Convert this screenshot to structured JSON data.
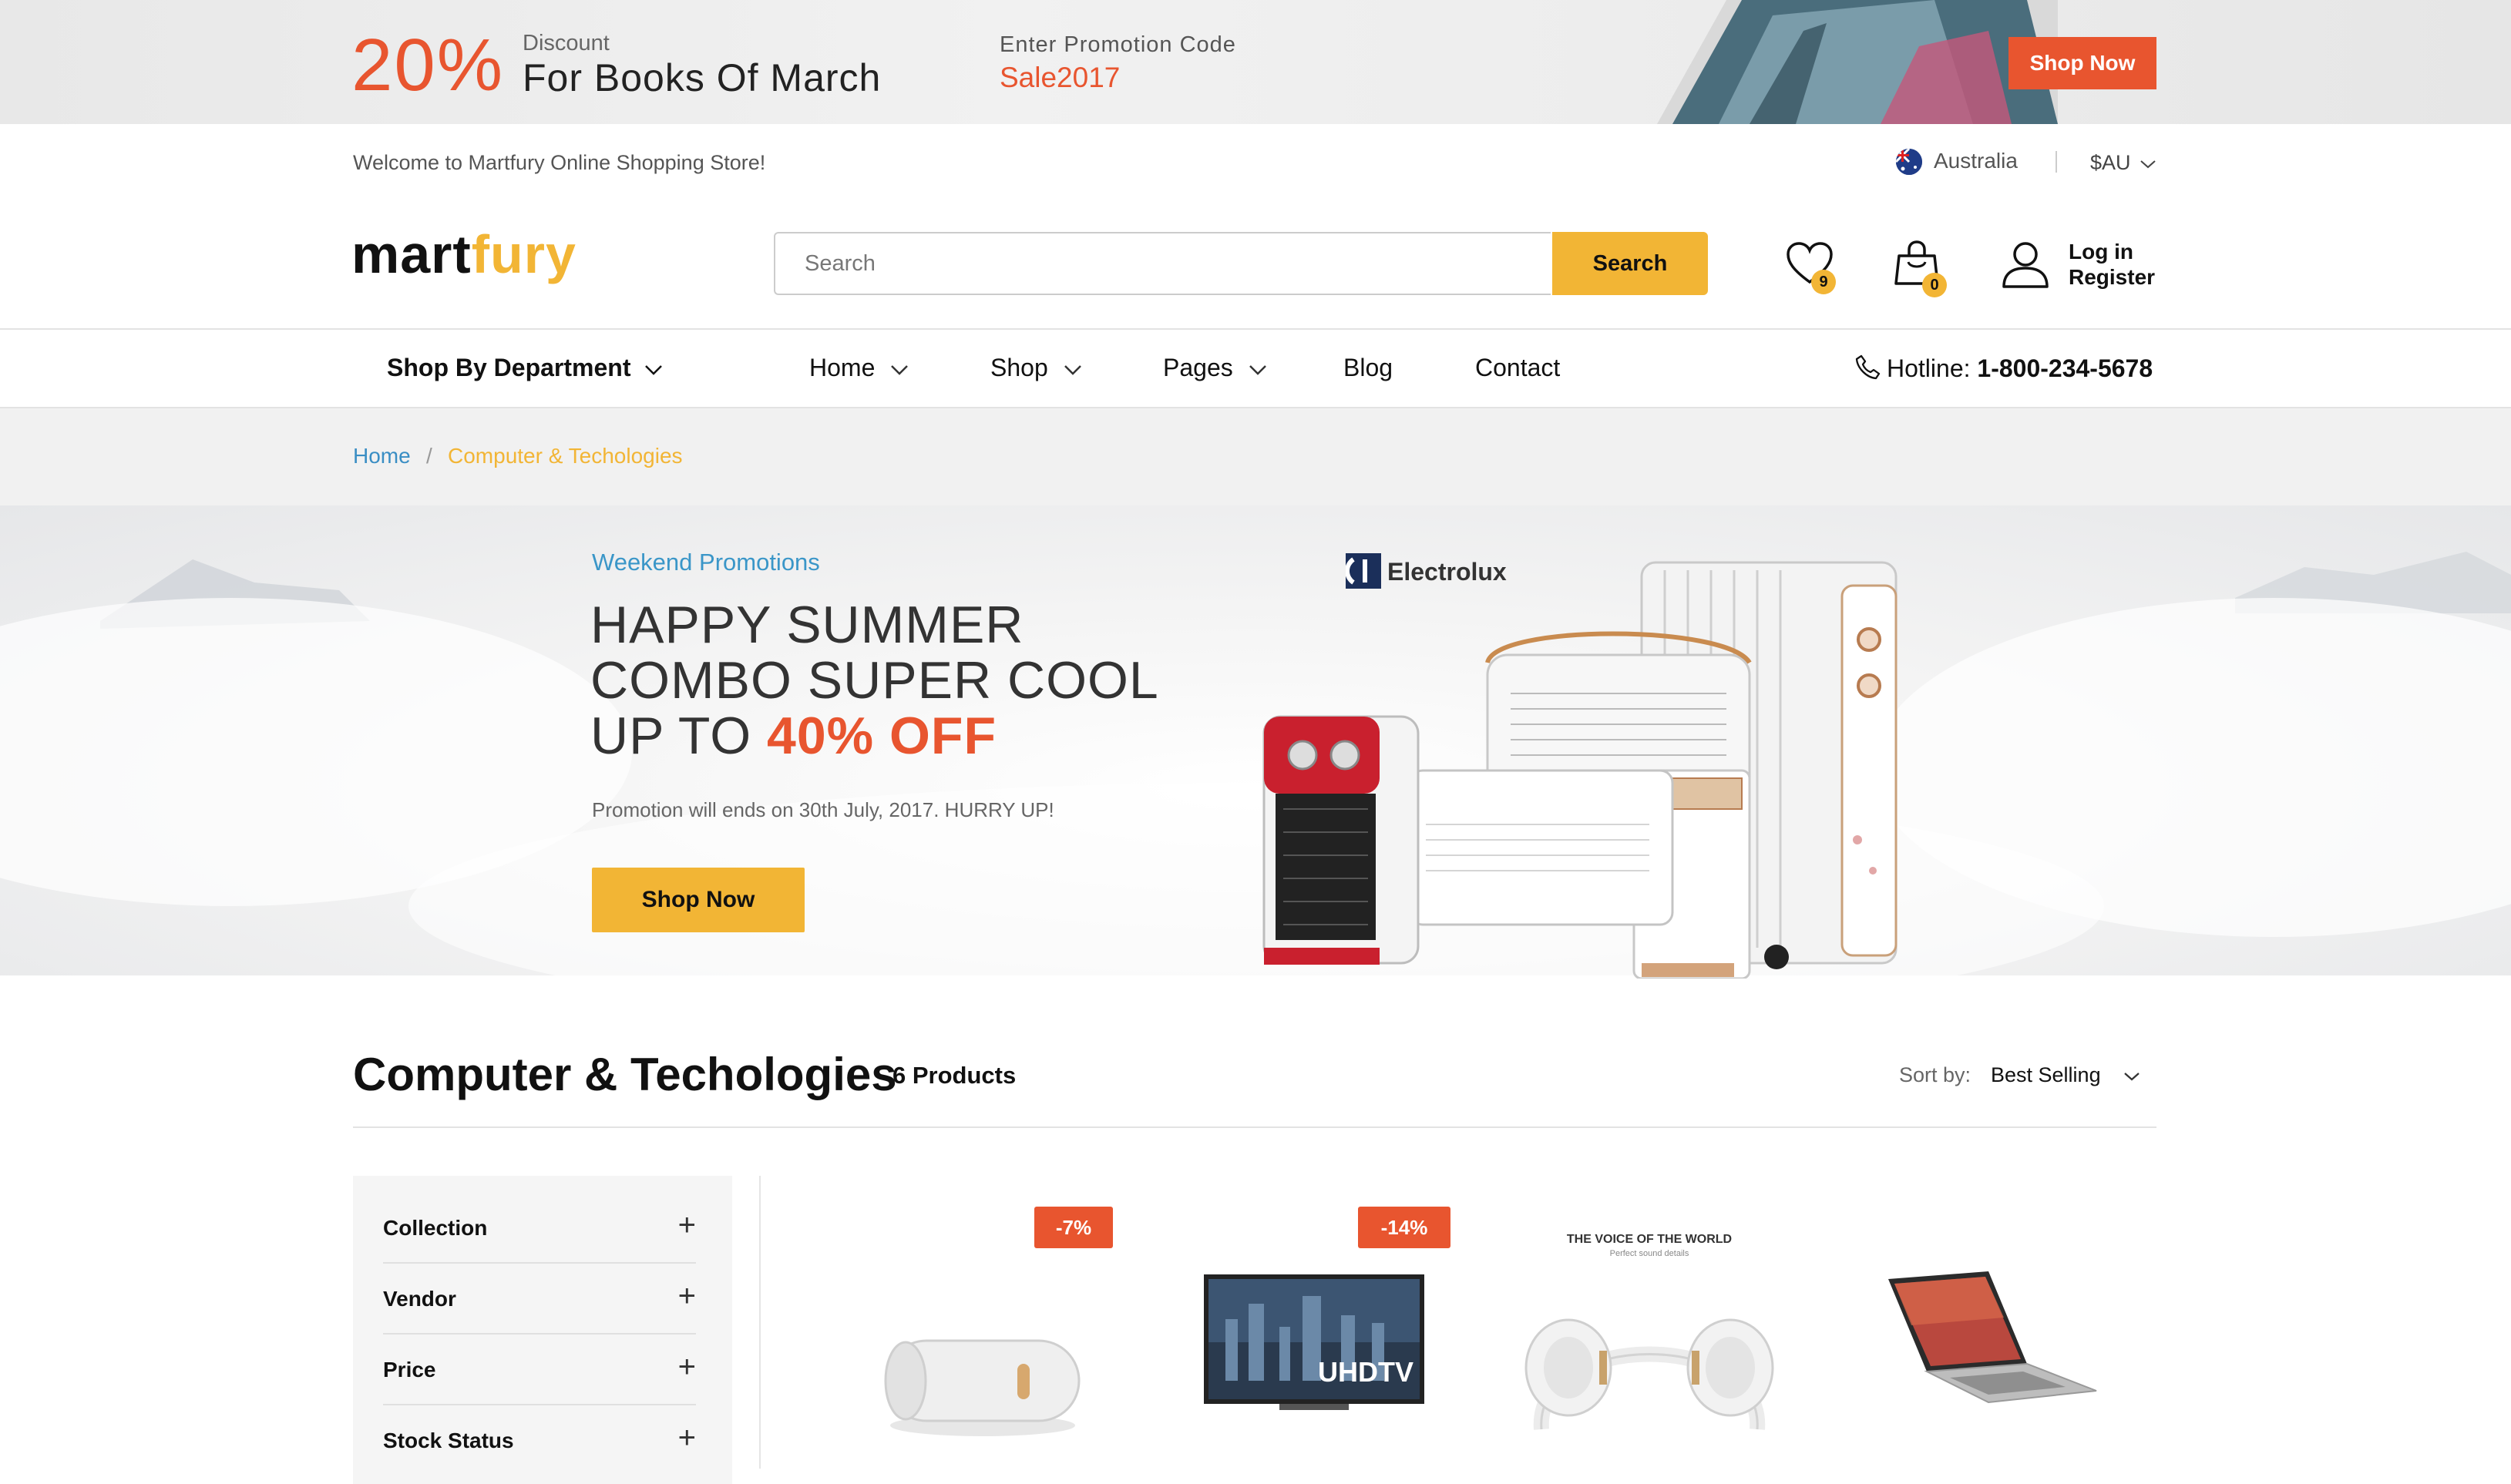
{
  "promo": {
    "percent": "20%",
    "discount_label": "Discount",
    "headline": "For Books Of March",
    "code_label": "Enter Promotion Code",
    "code": "Sale2017",
    "button": "Shop Now"
  },
  "topbar": {
    "welcome": "Welcome to Martfury Online Shopping Store!",
    "country": "Australia",
    "currency": "$AU"
  },
  "header": {
    "logo_main": "mart",
    "logo_accent": "fury",
    "search_placeholder": "Search",
    "search_button": "Search",
    "wishlist_count": "9",
    "cart_count": "0",
    "login": "Log in",
    "register": "Register"
  },
  "nav": {
    "department": "Shop By Department",
    "items": [
      "Home",
      "Shop",
      "Pages",
      "Blog",
      "Contact"
    ],
    "hotline_label": "Hotline:",
    "hotline_number": "1-800-234-5678"
  },
  "breadcrumb": {
    "home": "Home",
    "separator": "/",
    "current": "Computer & Techologies"
  },
  "hero": {
    "tag": "Weekend Promotions",
    "line1": "HAPPY SUMMER",
    "line2": "COMBO SUPER COOL",
    "line3_prefix": "UP TO",
    "line3_highlight": "40% OFF",
    "note": "Promotion will ends on 30th July, 2017. HURRY UP!",
    "button": "Shop Now",
    "brand": "Electrolux"
  },
  "category": {
    "title": "Computer & Techologies",
    "count": "6 Products",
    "sort_label": "Sort by:",
    "sort_value": "Best Selling"
  },
  "filters": [
    "Collection",
    "Vendor",
    "Price",
    "Stock Status"
  ],
  "products": [
    {
      "discount": "-7%",
      "icon": "speaker-icon"
    },
    {
      "discount": "-14%",
      "icon": "tv-icon",
      "screen_text": "UHDTV"
    },
    {
      "discount": "",
      "icon": "headphones-icon",
      "caption": "THE VOICE OF THE WORLD",
      "subcaption": "Perfect sound details"
    },
    {
      "discount": "",
      "icon": "laptop-icon"
    }
  ],
  "colors": {
    "accent": "#f2b535",
    "promo": "#e8552f",
    "link": "#3a8ec4"
  }
}
